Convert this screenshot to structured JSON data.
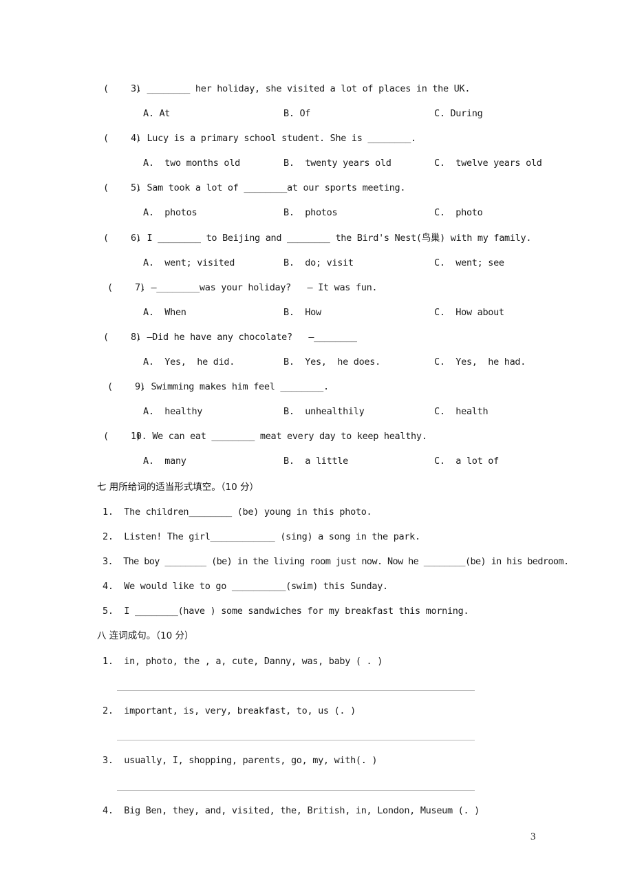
{
  "multiple_choice": [
    {
      "bracket": "(     )",
      "number": "3.",
      "stem": "________ her holiday, she visited a lot of places in the UK.",
      "options": [
        "A. At",
        "B. Of",
        "C. During"
      ]
    },
    {
      "bracket": "(     )",
      "number": "4.",
      "stem": "Lucy is a primary school student. She is ________.",
      "options": [
        "A.  two months old",
        "B.  twenty years old",
        "C.  twelve years old"
      ]
    },
    {
      "bracket": "(     )",
      "number": "5.",
      "stem": "Sam took a lot of ________at our sports meeting.",
      "options": [
        "A.  photos",
        "B.  photos",
        "C.  photo"
      ]
    },
    {
      "bracket": "(     )",
      "number": "6.",
      "stem": "I ________ to Beijing and ________ the Bird's Nest(鸟巢) with my family.",
      "options": [
        "A.  went; visited",
        "B.  do; visit",
        "C.  went; see"
      ]
    },
    {
      "bracket": "(     )",
      "number": "7.",
      "stem": "—________was your holiday?   — It was fun.",
      "options": [
        "A.  When",
        "B.  How",
        "C.  How about"
      ]
    },
    {
      "bracket": "(     )",
      "number": "8.",
      "stem": "—Did he have any chocolate?   —________",
      "options": [
        "A.  Yes,  he did.",
        "B.  Yes,  he does.",
        "C.  Yes,  he had."
      ]
    },
    {
      "bracket": "(     )",
      "number": "9.",
      "stem": "Swimming makes him feel ________.",
      "options": [
        "A.  healthy",
        "B.  unhealthily",
        "C.  health"
      ]
    },
    {
      "bracket": "(     )",
      "number": "10.",
      "stem": "We can eat ________ meat every day to keep healthy.",
      "options": [
        "A.  many",
        "B.  a little",
        "C.  a lot of"
      ]
    }
  ],
  "section7": {
    "title": "七 用所给词的适当形式填空。（10 分）",
    "items": [
      "1.  The children________ (be) young in this photo.",
      "2.  Listen! The girl____________ (sing) a song in the park.",
      "3.  The boy ________ (be) in the living room just now. Now he ________(be) in his bedroom.",
      "4.  We would like to go __________(swim) this Sunday.",
      "5.  I ________(have ) some sandwiches for my breakfast this morning."
    ]
  },
  "section8": {
    "title": "八 连词成句。（10 分）",
    "items": [
      "1.  in, photo, the , a, cute, Danny, was, baby ( . )",
      "2.  important, is, very, breakfast, to, us (. )",
      "3.  usually, I, shopping, parents, go, my, with(. )",
      "4.  Big Ben, they, and, visited, the, British, in, London, Museum (. )"
    ]
  },
  "page_number": "3"
}
